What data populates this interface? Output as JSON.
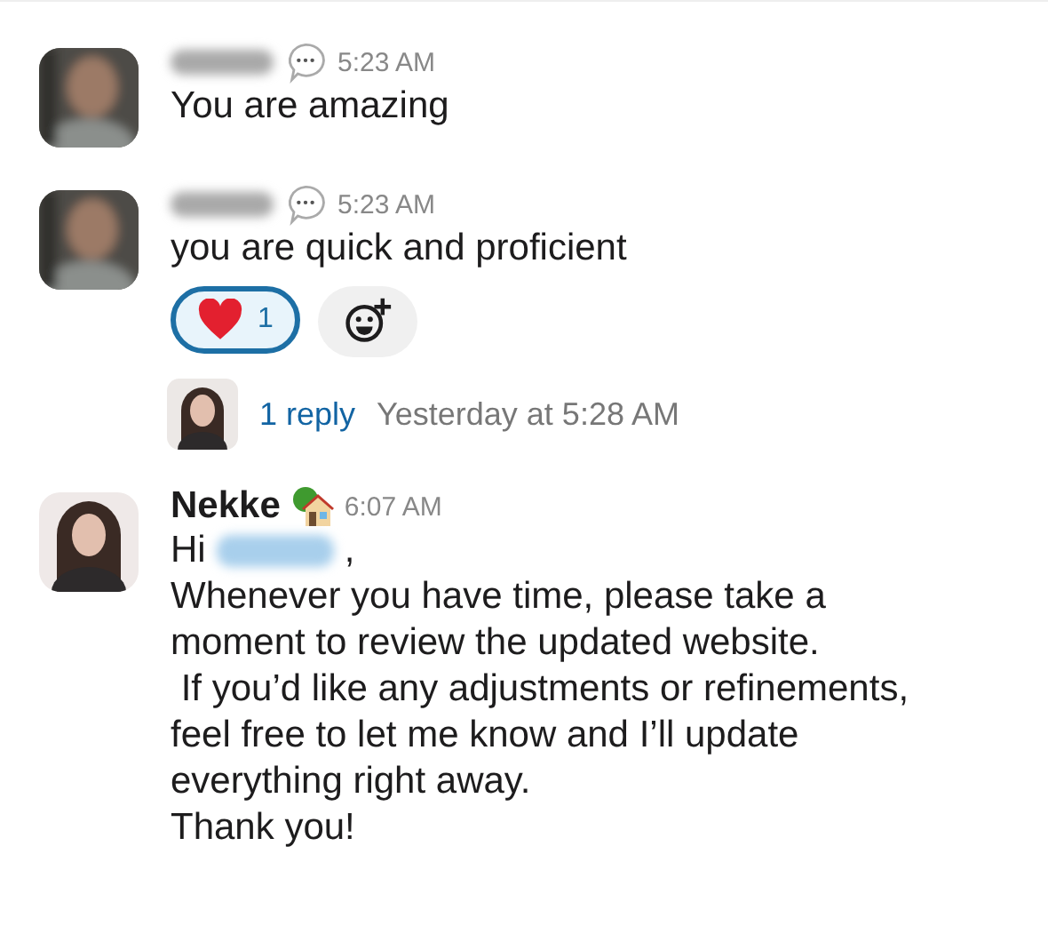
{
  "messages": [
    {
      "time": "5:23 AM",
      "text": "You are amazing"
    },
    {
      "time": "5:23 AM",
      "text": "you are quick and proficient",
      "reactions": [
        {
          "count": "1",
          "selected": true
        }
      ],
      "thread": {
        "replies": "1 reply",
        "last_reply": "Yesterday at 5:28 AM"
      }
    }
  ],
  "last_message": {
    "sender": "Nekke",
    "time": "6:07 AM",
    "greeting": "Hi",
    "greeting_end": ",",
    "lines": [
      "Whenever you have time, please take a",
      "moment to review the updated website.",
      " If you’d like any adjustments or refinements,",
      "feel free to let me know and I’ll update",
      "everything right away.",
      "Thank you!"
    ]
  }
}
